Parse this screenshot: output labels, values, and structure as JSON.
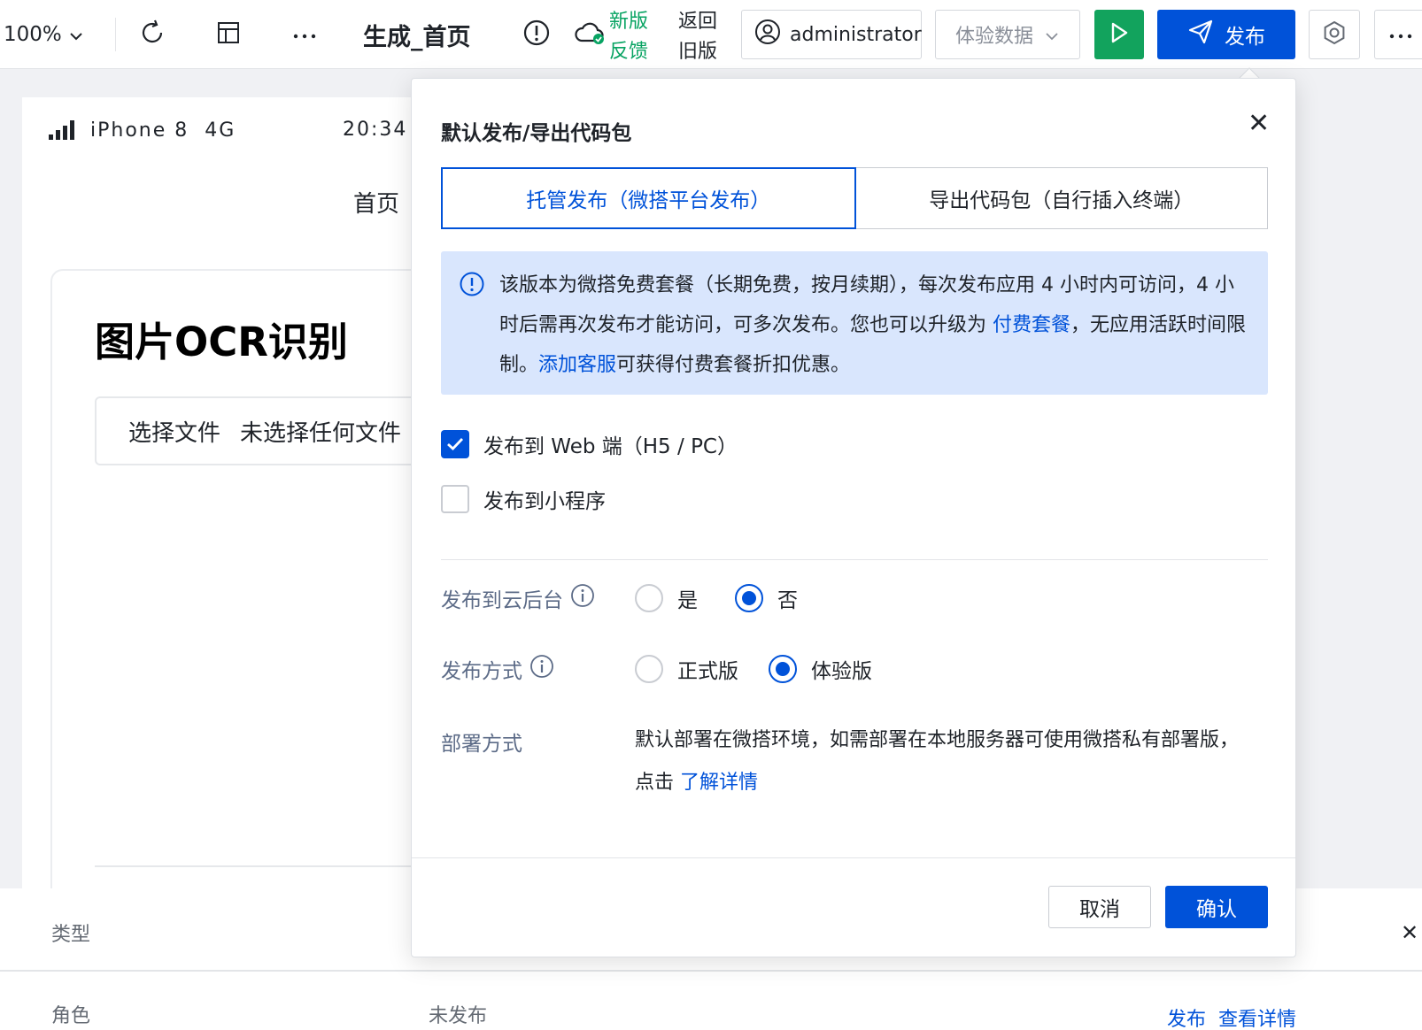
{
  "toolbar": {
    "zoom": "100%",
    "page_name": "生成_首页",
    "feedback_line1": "新版",
    "feedback_line2": "反馈",
    "oldver_line1": "返回",
    "oldver_line2": "旧版",
    "user": "administrator",
    "data_select": "体验数据",
    "publish_label": "发布",
    "accent_color": "#0052d9",
    "run_color": "#12a35d"
  },
  "phone": {
    "carrier": "iPhone 8",
    "network": "4G",
    "time": "20:34",
    "nav_title": "首页",
    "card_title": "图片OCR识别",
    "file_button": "选择文件",
    "file_status": "未选择任何文件"
  },
  "dialog": {
    "title": "默认发布/导出代码包",
    "tabs": [
      {
        "label": "托管发布（微搭平台发布）",
        "active": true
      },
      {
        "label": "导出代码包（自行插入终端）",
        "active": false
      }
    ],
    "notice": {
      "text_before": "该版本为微搭免费套餐（长期免费，按月续期），每次发布应用 4 小时内可访问，4 小时后需再次发布才能访问，可多次发布。您也可以升级为 ",
      "link_paid": "付费套餐",
      "text_mid": "，无应用活跃时间限制。",
      "link_service": "添加客服",
      "text_after": "可获得付费套餐折扣优惠。"
    },
    "targets": [
      {
        "label": "发布到 Web 端（H5 / PC）",
        "checked": true
      },
      {
        "label": "发布到小程序",
        "checked": false
      }
    ],
    "cloud_backend": {
      "label": "发布到云后台",
      "options": [
        "是",
        "否"
      ],
      "selected": "否"
    },
    "publish_mode": {
      "label": "发布方式",
      "options": [
        "正式版",
        "体验版"
      ],
      "selected": "体验版"
    },
    "deploy": {
      "label": "部署方式",
      "text": "默认部署在微搭环境，如需部署在本地服务器可使用微搭私有部署版，点击 ",
      "link": "了解详情"
    },
    "cancel": "取消",
    "confirm": "确认"
  },
  "bottom_panel": {
    "type_label": "类型",
    "role_label": "角色",
    "status": "未发布",
    "publish_link": "发布",
    "detail_link": "查看详情"
  }
}
